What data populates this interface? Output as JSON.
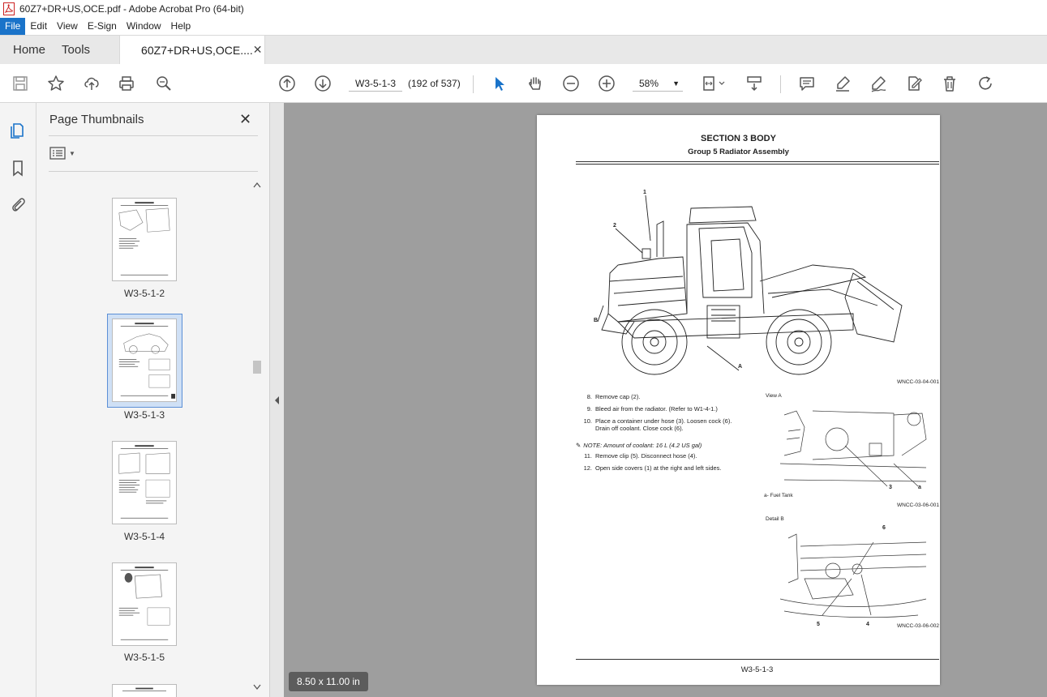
{
  "window": {
    "title": "60Z7+DR+US,OCE.pdf - Adobe Acrobat Pro (64-bit)"
  },
  "menu": [
    "File",
    "Edit",
    "View",
    "E-Sign",
    "Window",
    "Help"
  ],
  "tabs": {
    "home": "Home",
    "tools": "Tools",
    "document": "60Z7+DR+US,OCE....",
    "close": "✕"
  },
  "toolbar": {
    "page_label": "W3-5-1-3",
    "page_count": "(192 of 537)",
    "zoom": "58%",
    "icons": [
      "save-icon",
      "star-icon",
      "upload-icon",
      "print-icon",
      "search-zoom-icon",
      "arrow-up-icon",
      "arrow-down-icon",
      "select-arrow-icon",
      "hand-icon",
      "zoom-out-icon",
      "zoom-in-icon",
      "fit-page-icon",
      "scroll-mode-icon",
      "comment-icon",
      "highlight-icon",
      "sign-icon",
      "edit-pdf-icon",
      "delete-icon",
      "rotate-icon"
    ]
  },
  "panel": {
    "title": "Page Thumbnails",
    "close": "✕",
    "thumbnails": [
      {
        "label": "W3-5-1-2",
        "selected": false
      },
      {
        "label": "W3-5-1-3",
        "selected": true
      },
      {
        "label": "W3-5-1-4",
        "selected": false
      },
      {
        "label": "W3-5-1-5",
        "selected": false
      }
    ]
  },
  "page": {
    "section": "SECTION 3 BODY",
    "group": "Group 5 Radiator Assembly",
    "fig1_code": "WNCC-03-04-001",
    "steps": [
      {
        "n": "8.",
        "text": "Remove cap (2)."
      },
      {
        "n": "9.",
        "text": "Bleed air from the radiator. (Refer to W1-4-1.)"
      },
      {
        "n": "10.",
        "text": "Place a container under hose (3). Loosen cock (6). Drain off coolant. Close cock (6)."
      },
      {
        "n": "11.",
        "text": "Remove clip (5). Disconnect hose (4)."
      },
      {
        "n": "12.",
        "text": "Open side covers (1) at the right and left sides."
      }
    ],
    "note": "NOTE:     Amount of coolant: 16 L (4.2 US gal)",
    "view_a": "View A",
    "view_a_legend": "a-     Fuel Tank",
    "fig2_code": "WNCC-03-06-001",
    "detail_b": "Detail B",
    "fig3_code": "WNCC-03-06-002",
    "callouts_fig1": [
      "1",
      "2",
      "B",
      "A"
    ],
    "callouts_fig2": [
      "3",
      "a"
    ],
    "callouts_fig3": [
      "6",
      "5",
      "4"
    ],
    "footer": "W3-5-1-3"
  },
  "status": {
    "page_size": "8.50 x 11.00 in"
  },
  "colors": {
    "accent": "#1a73c9",
    "doc_bg": "#9e9e9e",
    "panel_bg": "#f4f4f4",
    "icon": "#555555"
  }
}
